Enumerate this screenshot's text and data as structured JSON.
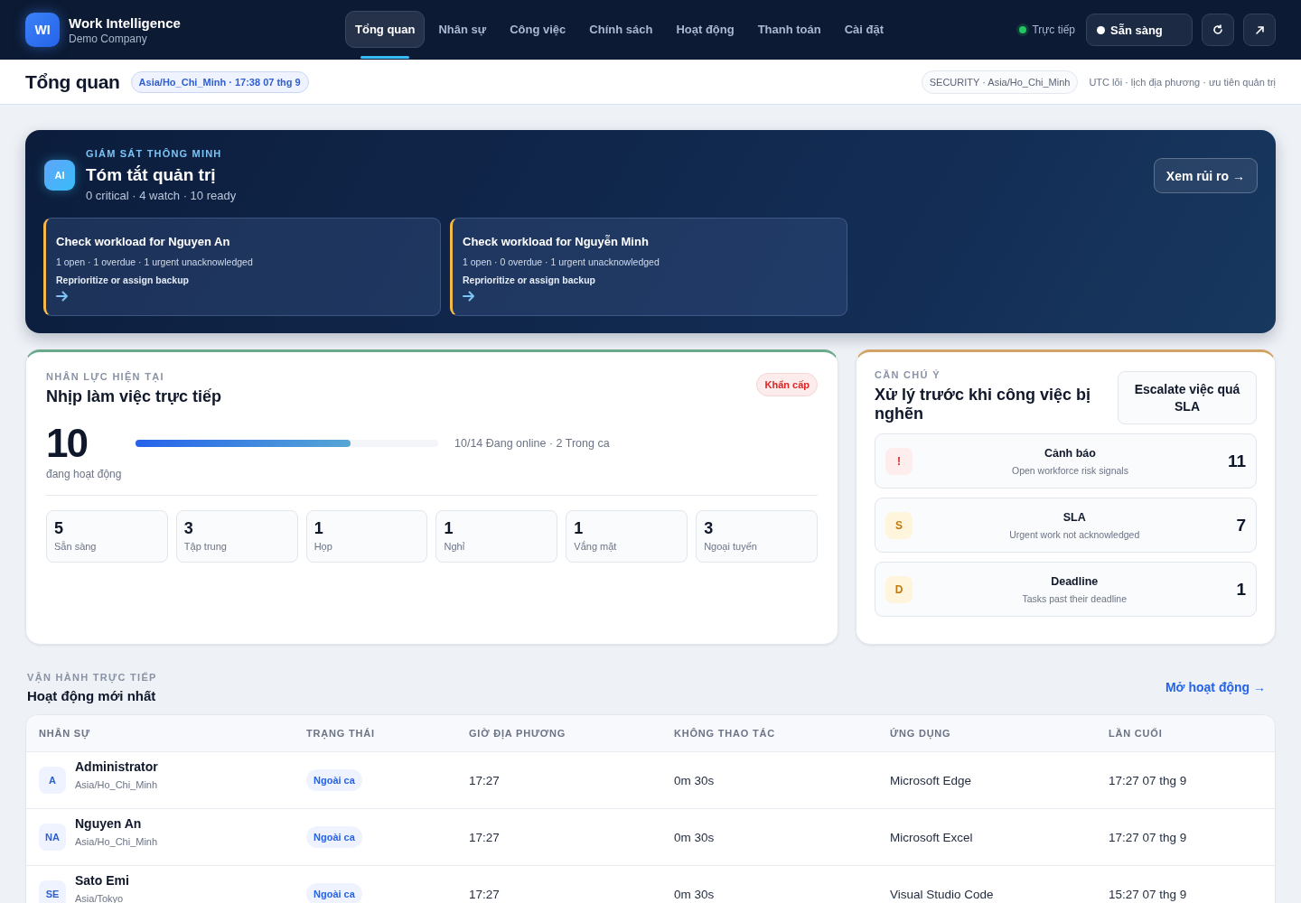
{
  "topbar": {
    "logo": "WI",
    "brand": "Work Intelligence",
    "company": "Demo Company",
    "tabs": [
      {
        "label": "Tổng quan",
        "selected": true
      },
      {
        "label": "Nhân sự",
        "selected": false
      },
      {
        "label": "Công việc",
        "selected": false
      },
      {
        "label": "Chính sách",
        "selected": false
      },
      {
        "label": "Hoạt động",
        "selected": false
      },
      {
        "label": "Thanh toán",
        "selected": false
      },
      {
        "label": "Cài đặt",
        "selected": false
      }
    ],
    "live": {
      "label": "Trực tiếp",
      "on": true
    },
    "status": "Sẵn sàng"
  },
  "header": {
    "title": "Tổng quan",
    "timezone": "Asia/Ho_Chi_Minh · 17:38 07 thg 9",
    "security": "SECURITY · Asia/Ho_Chi_Minh",
    "note": "UTC lõi · lịch địa phương · ưu tiên quản trị"
  },
  "banner": {
    "icon": "AI",
    "eyebrow": "GIÁM SÁT THÔNG MINH",
    "title": "Tóm tắt quản trị",
    "summary": "0 critical · 4 watch · 10 ready",
    "button": "Xem rủi ro →",
    "insights": [
      {
        "title": "Check workload for Nguyen An",
        "meta": "1 open · 1 overdue · 1 urgent unacknowledged",
        "action": "Reprioritize or assign backup"
      },
      {
        "title": "Check workload for Nguyễn Minh",
        "meta": "1 open · 0 overdue · 1 urgent unacknowledged",
        "action": "Reprioritize or assign backup"
      }
    ]
  },
  "workforce": {
    "eyebrow": "NHÂN LỰC HIỆN TẠI",
    "title": "Nhịp làm việc trực tiếp",
    "badge": "Khẩn cấp",
    "count": "10",
    "count_label": "đang hoạt động",
    "level": 0.71,
    "reading": "10/14 Đang online · 2 Trong ca",
    "stats": [
      {
        "value": "5",
        "label": "Sẵn sàng"
      },
      {
        "value": "3",
        "label": "Tập trung"
      },
      {
        "value": "1",
        "label": "Họp"
      },
      {
        "value": "1",
        "label": "Nghỉ"
      },
      {
        "value": "1",
        "label": "Vắng mặt"
      },
      {
        "value": "3",
        "label": "Ngoại tuyến"
      }
    ]
  },
  "attention": {
    "eyebrow": "CẦN CHÚ Ý",
    "title": "Xử lý trước khi công việc bị nghẽn",
    "button": "Escalate việc quá SLA",
    "items": [
      {
        "kind": "danger",
        "badge": "!",
        "title": "Cảnh báo",
        "subtitle": "Open workforce risk signals",
        "count": "11"
      },
      {
        "kind": "warning",
        "badge": "S",
        "title": "SLA",
        "subtitle": "Urgent work not acknowledged",
        "count": "7"
      },
      {
        "kind": "warning",
        "badge": "D",
        "title": "Deadline",
        "subtitle": "Tasks past their deadline",
        "count": "1"
      }
    ]
  },
  "activity": {
    "eyebrow": "VẬN HÀNH TRỰC TIẾP",
    "title": "Hoạt động mới nhất",
    "link": "Mở hoạt động →",
    "columns": [
      "NHÂN SỰ",
      "TRẠNG THÁI",
      "GIỜ ĐỊA PHƯƠNG",
      "KHÔNG THAO TÁC",
      "ỨNG DỤNG",
      "LẦN CUỐI"
    ],
    "rows": [
      {
        "initials": "A",
        "name": "Administrator",
        "timezone": "Asia/Ho_Chi_Minh",
        "status": "Ngoài ca",
        "local": "17:27",
        "idle": "0m 30s",
        "app": "Microsoft Edge",
        "last": "17:27 07 thg 9"
      },
      {
        "initials": "NA",
        "name": "Nguyen An",
        "timezone": "Asia/Ho_Chi_Minh",
        "status": "Ngoài ca",
        "local": "17:27",
        "idle": "0m 30s",
        "app": "Microsoft Excel",
        "last": "17:27 07 thg 9"
      },
      {
        "initials": "SE",
        "name": "Sato Emi",
        "timezone": "Asia/Tokyo",
        "status": "Ngoài ca",
        "local": "17:27",
        "idle": "0m 30s",
        "app": "Visual Studio Code",
        "last": "15:27 07 thg 9"
      }
    ]
  }
}
